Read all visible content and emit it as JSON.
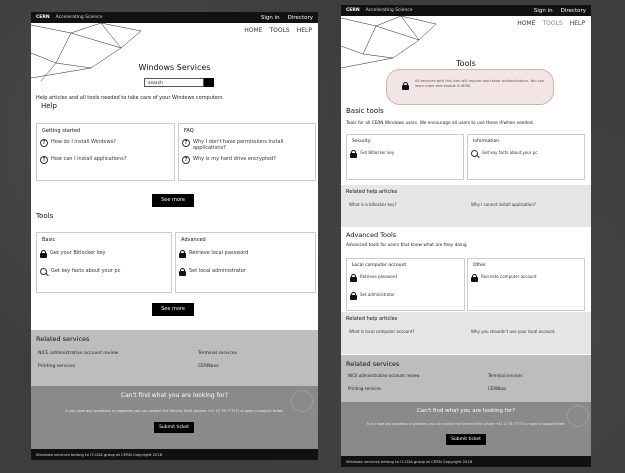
{
  "common": {
    "brand": "CERN",
    "tagline": "Accelerating Science",
    "signin": "Sign in",
    "directory": "Directory",
    "nav": [
      "HOME",
      "TOOLS",
      "HELP"
    ],
    "see_more": "See more",
    "related_title": "Related services",
    "related_items": [
      "NICE administrative account review",
      "Terminal services",
      "Printing services",
      "CERNbox"
    ],
    "cant_find": "Can't find what you are looking for?",
    "cant_text": "If you have any questions or problems you can contact the Service Desk (phone +41 22 76 77777) or open a support ticket.",
    "submit": "Submit ticket",
    "footer": "Windows services belong to IT-CDA group at CERN Copyright 2018"
  },
  "left": {
    "title": "Windows Services",
    "search_placeholder": "search",
    "intro": "Help articles and all tools needed to take care of your Windows computers",
    "help_heading": "Help",
    "getting_started": {
      "title": "Getting started",
      "items": [
        "How do I install Windows?",
        "How can I install applications?"
      ]
    },
    "faq": {
      "title": "FAQ",
      "items": [
        "Why I don't have permissions install applications?",
        "Why is my hard drive encrypted?"
      ]
    },
    "tools_heading": "Tools",
    "basic": {
      "title": "Basic",
      "items": [
        "Get your Bitlocker key",
        "Get key facts about your pc"
      ]
    },
    "advanced": {
      "title": "Advanced",
      "items": [
        "Retrieve local password",
        "Set local administrator"
      ]
    }
  },
  "right": {
    "title": "Tools",
    "notice": "All services with this icon will require two factor authentication. You can learn more and enable it HERE.",
    "basic_heading": "Basic tools",
    "basic_intro": "Tools for all CERN Windows users. We encourage all users to use these if/when needed.",
    "security": {
      "title": "Security",
      "item": "Get Bitlocker key"
    },
    "information": {
      "title": "Information",
      "item": "Get key facts about your pc"
    },
    "rel1_title": "Related help articles",
    "rel1_items": [
      "What is a bitlocker key?",
      "Why I cannot install application?"
    ],
    "adv_heading": "Advanced Tools",
    "adv_intro": "Advanced tools for users that know what are they doing",
    "local": {
      "title": "Local computer account",
      "items": [
        "Retrieve password",
        "Set administrator"
      ]
    },
    "other": {
      "title": "Other",
      "item": "Recreate computer account"
    },
    "rel2_title": "Related help articles",
    "rel2_items": [
      "What is local computer account?",
      "Why you shouldn't use your local account"
    ]
  }
}
